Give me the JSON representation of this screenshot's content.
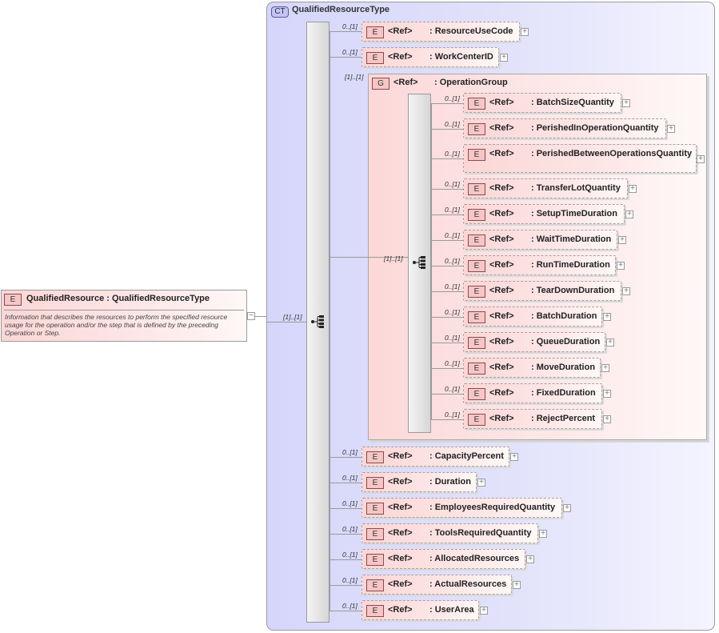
{
  "complex_type": {
    "badge": "CT",
    "name": "QualifiedResourceType"
  },
  "root": {
    "badge": "E",
    "title": "QualifiedResource : QualifiedResourceType",
    "documentation": "Information that describes the resources to perform the specified resource usage for the operation and/or the step that is defined by the preceding Operation or Step.",
    "collapse": "−"
  },
  "root_occurrence": "[1]..[1]",
  "group": {
    "badge": "G",
    "ref": "<Ref>",
    "name": ": OperationGroup",
    "occurrence": "[1]..[1]",
    "seq_occurrence": "[1]..[1]"
  },
  "outer_elements": [
    {
      "badge": "E",
      "ref": "<Ref>",
      "name": ": ResourceUseCode",
      "occurrence": "0..[1]",
      "expand": "+"
    },
    {
      "badge": "E",
      "ref": "<Ref>",
      "name": ": WorkCenterID",
      "occurrence": "0..[1]",
      "expand": "+"
    },
    {
      "badge": "E",
      "ref": "<Ref>",
      "name": ": CapacityPercent",
      "occurrence": "0..[1]",
      "expand": "+"
    },
    {
      "badge": "E",
      "ref": "<Ref>",
      "name": ": Duration",
      "occurrence": "0..[1]",
      "expand": "+"
    },
    {
      "badge": "E",
      "ref": "<Ref>",
      "name": ": EmployeesRequiredQuantity",
      "occurrence": "0..[1]",
      "expand": "+"
    },
    {
      "badge": "E",
      "ref": "<Ref>",
      "name": ": ToolsRequiredQuantity",
      "occurrence": "0..[1]",
      "expand": "+"
    },
    {
      "badge": "E",
      "ref": "<Ref>",
      "name": ": AllocatedResources",
      "occurrence": "0..[1]",
      "expand": "+"
    },
    {
      "badge": "E",
      "ref": "<Ref>",
      "name": ": ActualResources",
      "occurrence": "0..[1]",
      "expand": "+"
    },
    {
      "badge": "E",
      "ref": "<Ref>",
      "name": ": UserArea",
      "occurrence": "0..[1]",
      "expand": "+"
    }
  ],
  "group_elements": [
    {
      "badge": "E",
      "ref": "<Ref>",
      "name": ": BatchSizeQuantity",
      "occurrence": "0..[1]",
      "expand": "+"
    },
    {
      "badge": "E",
      "ref": "<Ref>",
      "name": ": PerishedInOperationQuantity",
      "occurrence": "0..[1]",
      "expand": "+"
    },
    {
      "badge": "E",
      "ref": "<Ref>",
      "name": ": PerishedBetweenOperationsQuantity",
      "occurrence": "0..[1]",
      "expand": "+"
    },
    {
      "badge": "E",
      "ref": "<Ref>",
      "name": ": TransferLotQuantity",
      "occurrence": "0..[1]",
      "expand": "+"
    },
    {
      "badge": "E",
      "ref": "<Ref>",
      "name": ": SetupTimeDuration",
      "occurrence": "0..[1]",
      "expand": "+"
    },
    {
      "badge": "E",
      "ref": "<Ref>",
      "name": ": WaitTimeDuration",
      "occurrence": "0..[1]",
      "expand": "+"
    },
    {
      "badge": "E",
      "ref": "<Ref>",
      "name": ": RunTimeDuration",
      "occurrence": "0..[1]",
      "expand": "+"
    },
    {
      "badge": "E",
      "ref": "<Ref>",
      "name": ": TearDownDuration",
      "occurrence": "0..[1]",
      "expand": "+"
    },
    {
      "badge": "E",
      "ref": "<Ref>",
      "name": ": BatchDuration",
      "occurrence": "0..[1]",
      "expand": "+"
    },
    {
      "badge": "E",
      "ref": "<Ref>",
      "name": ": QueueDuration",
      "occurrence": "0..[1]",
      "expand": "+"
    },
    {
      "badge": "E",
      "ref": "<Ref>",
      "name": ": MoveDuration",
      "occurrence": "0..[1]",
      "expand": "+"
    },
    {
      "badge": "E",
      "ref": "<Ref>",
      "name": ": FixedDuration",
      "occurrence": "0..[1]",
      "expand": "+"
    },
    {
      "badge": "E",
      "ref": "<Ref>",
      "name": ": RejectPercent",
      "occurrence": "0..[1]",
      "expand": "+"
    }
  ],
  "colors": {
    "complex_type_fill": "#dcdcfb",
    "element_fill": "#fcd6d6",
    "border": "#9a9a9a"
  }
}
